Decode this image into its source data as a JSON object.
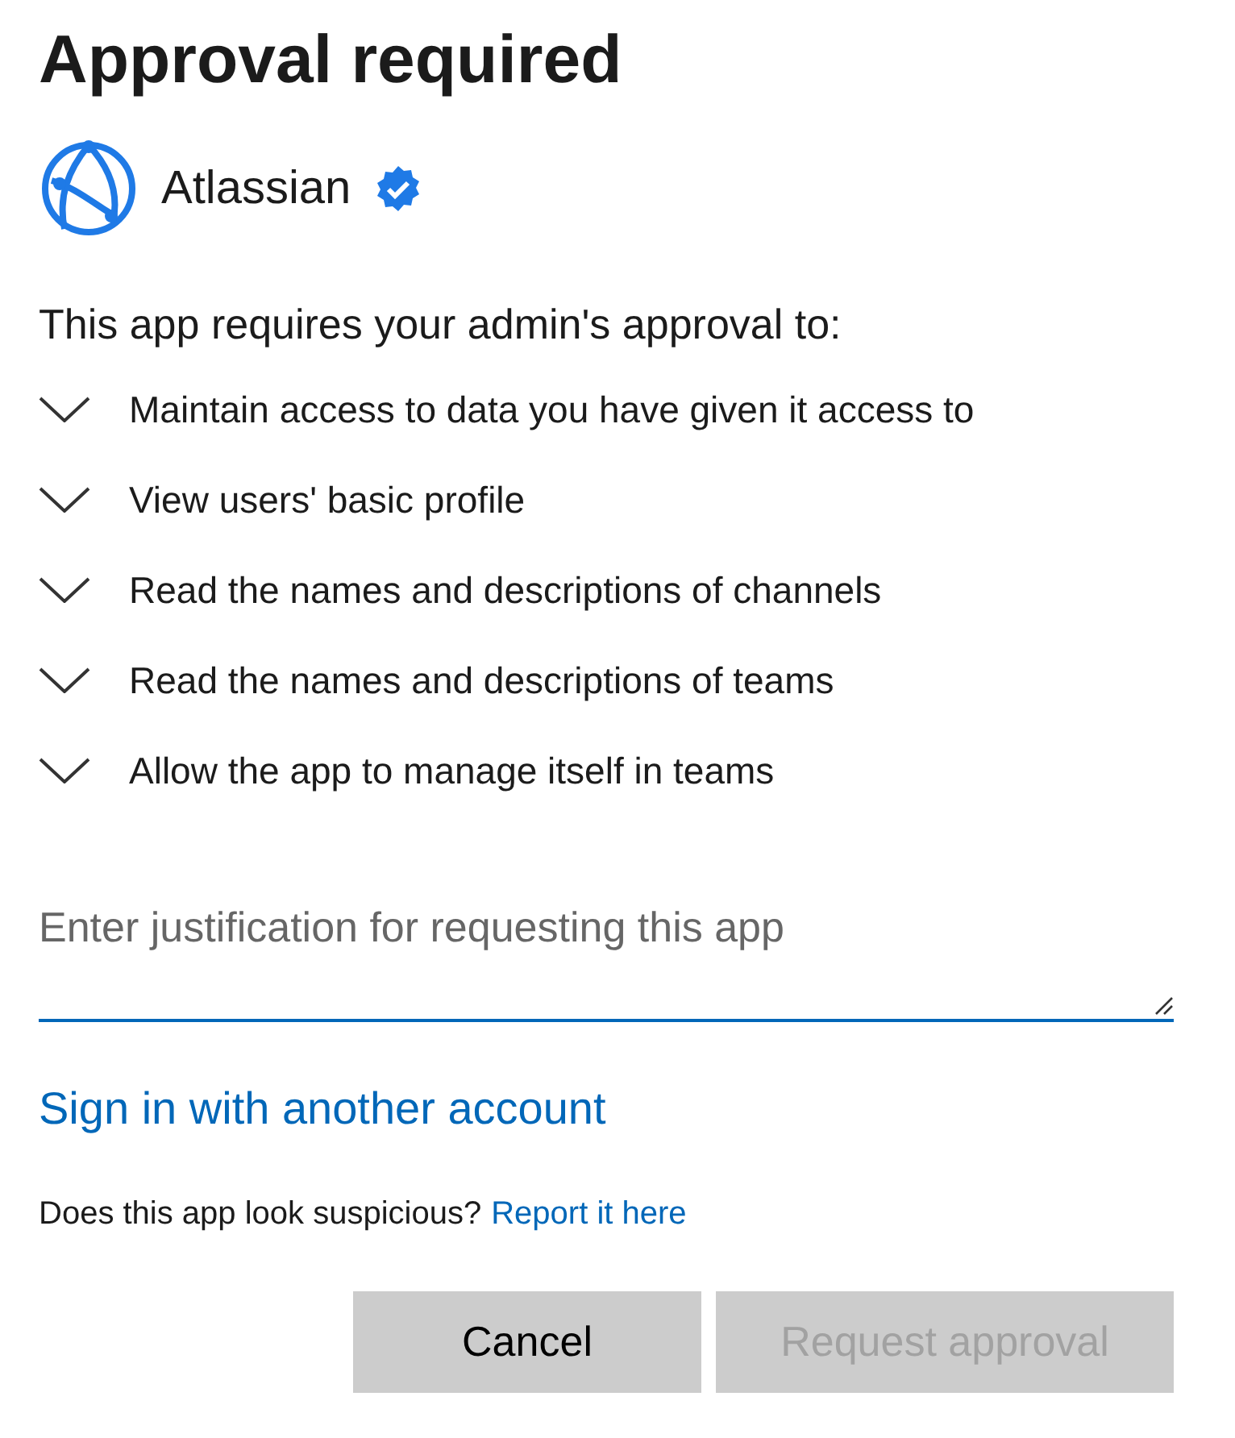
{
  "title": "Approval required",
  "app": {
    "name": "Atlassian",
    "verified": true
  },
  "intro": "This app requires your admin's approval to:",
  "permissions": [
    {
      "label": "Maintain access to data you have given it access to",
      "expanded": false
    },
    {
      "label": "View users' basic profile",
      "expanded": false
    },
    {
      "label": "Read the names and descriptions of channels",
      "expanded": false
    },
    {
      "label": "Read the names and descriptions of teams",
      "expanded": false
    },
    {
      "label": "Allow the app to manage itself in teams",
      "expanded": false
    }
  ],
  "justification": {
    "placeholder": "Enter justification for requesting this app"
  },
  "switch_account_link": "Sign in with another account",
  "suspicious": {
    "text": "Does this app look suspicious?",
    "link": "Report it here"
  },
  "buttons": [
    {
      "label": "Cancel",
      "disabled": false
    },
    {
      "label": "Request approval",
      "disabled": true
    }
  ]
}
